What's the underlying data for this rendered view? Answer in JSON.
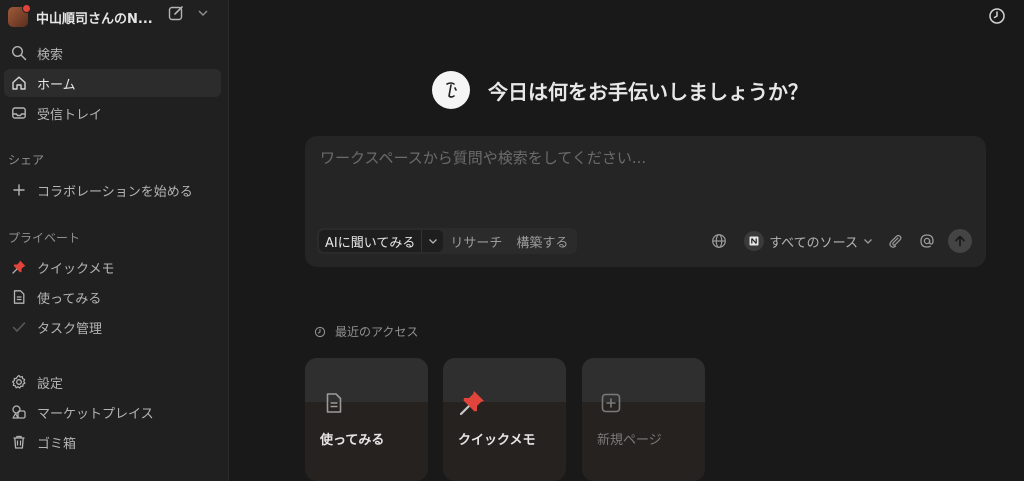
{
  "workspace": {
    "name": "中山順司さんのN..."
  },
  "sidebar": {
    "top_items": [
      {
        "label": "検索",
        "icon": "search-icon"
      },
      {
        "label": "ホーム",
        "icon": "home-icon",
        "active": true
      },
      {
        "label": "受信トレイ",
        "icon": "inbox-icon"
      }
    ],
    "share_label": "シェア",
    "share_items": [
      {
        "label": "コラボレーションを始める",
        "icon": "plus-icon"
      }
    ],
    "private_label": "プライベート",
    "private_items": [
      {
        "label": "クイックメモ",
        "icon": "pushpin-icon"
      },
      {
        "label": "使ってみる",
        "icon": "page-icon"
      },
      {
        "label": "タスク管理",
        "icon": "check-icon"
      }
    ],
    "bottom_items": [
      {
        "label": "設定",
        "icon": "gear-icon"
      },
      {
        "label": "マーケットプレイス",
        "icon": "marketplace-icon"
      },
      {
        "label": "ゴミ箱",
        "icon": "trash-icon"
      }
    ]
  },
  "hero": {
    "title": "今日は何をお手伝いしましょうか？"
  },
  "chat": {
    "placeholder": "ワークスペースから質問や検索をしてください...",
    "modes": {
      "ask": "AIに聞いてみる",
      "research": "リサーチ",
      "build": "構築する"
    },
    "sources_label": "すべてのソース"
  },
  "recent": {
    "label": "最近のアクセス",
    "cards": [
      {
        "title": "使ってみる",
        "icon": "page-icon"
      },
      {
        "title": "クイックメモ",
        "icon": "pushpin-icon"
      },
      {
        "title": "新規ページ",
        "icon": "plus-square-icon"
      }
    ]
  },
  "colors": {
    "background": "#191919",
    "sidebar": "#202020",
    "accent_pin": "#e0443a"
  }
}
